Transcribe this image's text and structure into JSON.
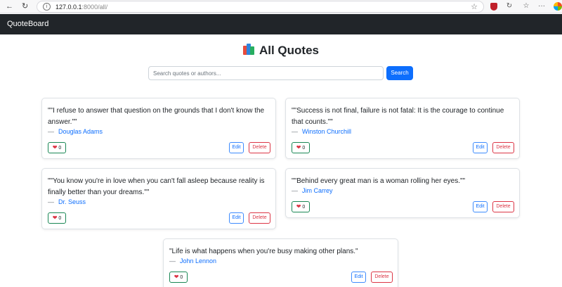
{
  "browser": {
    "back_icon": "back-arrow-icon",
    "reload_icon": "reload-icon",
    "url_host": "127.0.0.1",
    "url_rest": ":8000/all/",
    "bookmark_icon": "star-icon"
  },
  "navbar": {
    "brand": "QuoteBoard"
  },
  "heading": {
    "icon": "books-icon",
    "title": "All Quotes"
  },
  "search": {
    "placeholder": "Search quotes or authors...",
    "button_label": "Search"
  },
  "quotes": [
    {
      "text": "\"\"I refuse to answer that question on the grounds that I don't know the answer.\"\"",
      "author": "Douglas Adams",
      "likes": "0",
      "edit_label": "Edit",
      "delete_label": "Delete"
    },
    {
      "text": "\"\"Success is not final, failure is not fatal: It is the courage to continue that counts.\"\"",
      "author": "Winston Churchill",
      "likes": "0",
      "edit_label": "Edit",
      "delete_label": "Delete"
    },
    {
      "text": "\"\"You know you're in love when you can't fall asleep because reality is finally better than your dreams.\"\"",
      "author": "Dr. Seuss",
      "likes": "0",
      "edit_label": "Edit",
      "delete_label": "Delete"
    },
    {
      "text": "\"\"Behind every great man is a woman rolling her eyes.\"\"",
      "author": "Jim Carrey",
      "likes": "0",
      "edit_label": "Edit",
      "delete_label": "Delete"
    },
    {
      "text": "\"Life is what happens when you're busy making other plans.\"",
      "author": "John Lennon",
      "likes": "0",
      "edit_label": "Edit",
      "delete_label": "Delete"
    }
  ],
  "labels": {
    "author_dash": "—"
  },
  "colors": {
    "navbar_bg": "#212529",
    "primary": "#0d6efd",
    "danger": "#dc3545",
    "like_border": "#198754"
  }
}
